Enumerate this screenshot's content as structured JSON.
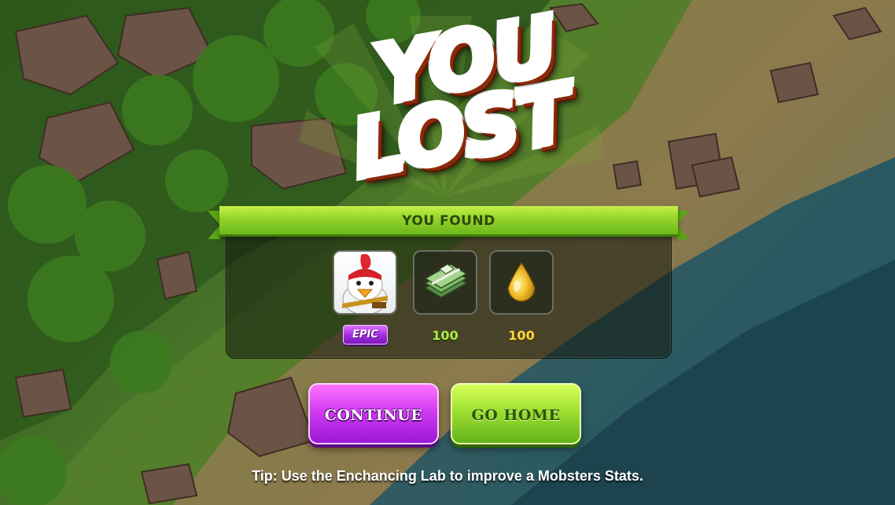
{
  "result": {
    "title_line1": "YOU",
    "title_line2": "LOST"
  },
  "rewards": {
    "header": "YOU FOUND",
    "items": [
      {
        "type": "mobster",
        "icon": "chicken-mobster-icon",
        "rarity": "EPIC"
      },
      {
        "type": "cash",
        "icon": "cash-stack-icon",
        "amount": "100"
      },
      {
        "type": "oil",
        "icon": "oil-drop-icon",
        "amount": "100"
      }
    ]
  },
  "buttons": {
    "continue": "CONTINUE",
    "go_home": "GO HOME"
  },
  "tip": "Tip: Use the Enchancing Lab to improve a Mobsters Stats.",
  "colors": {
    "title_orange": "#ff6a1a",
    "banner_green": "#93d32a",
    "epic_purple": "#a12be0",
    "cash_green": "#a6ec46",
    "oil_yellow": "#ffd83a",
    "continue_purple": "#d13cf2",
    "home_green": "#9fe033"
  }
}
